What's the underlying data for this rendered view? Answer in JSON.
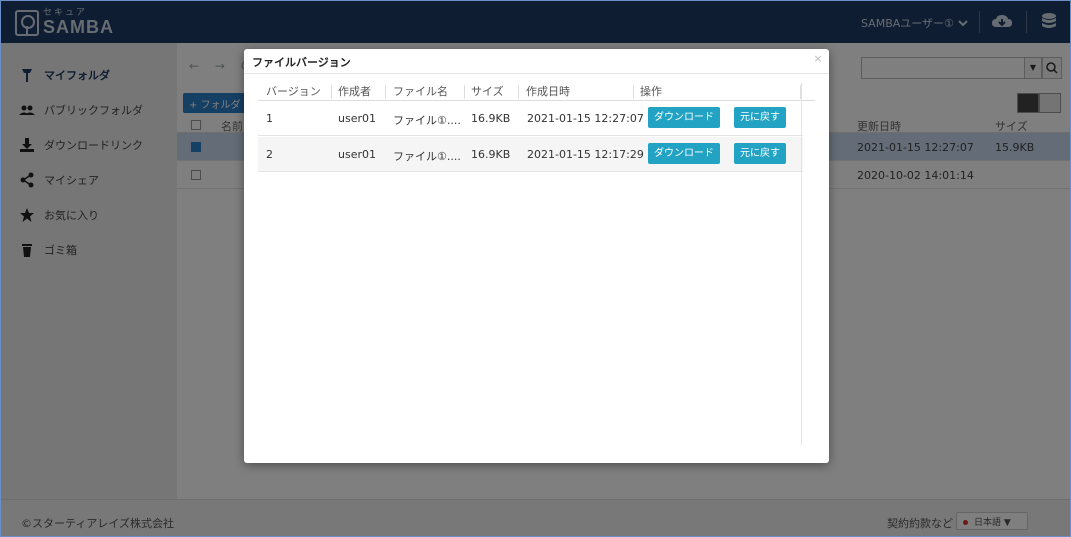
{
  "header": {
    "logo_sub": "セキュア",
    "logo_main": "SAMBA",
    "user_name": "SAMBAユーザー①",
    "colors": {
      "header_bg": "#1d3a63",
      "accent": "#23a3c4"
    }
  },
  "sidebar": {
    "items": [
      {
        "label": "マイフォルダ",
        "icon": "mydrive-icon",
        "active": true
      },
      {
        "label": "パブリックフォルダ",
        "icon": "users-icon"
      },
      {
        "label": "ダウンロードリンク",
        "icon": "download-icon"
      },
      {
        "label": "マイシェア",
        "icon": "share-icon"
      },
      {
        "label": "お気に入り",
        "icon": "star-icon"
      },
      {
        "label": "ゴミ箱",
        "icon": "trash-icon"
      }
    ]
  },
  "main": {
    "nav_arrows": "← → C",
    "new_folder_label": "+ フォルダ",
    "table_headers": {
      "name": "名前",
      "updated": "更新日時",
      "size": "サイズ"
    },
    "rows": [
      {
        "updated": "2021-01-15 12:27:07",
        "size": "15.9KB",
        "checked": true
      },
      {
        "updated": "2020-10-02 14:01:14",
        "size": "",
        "checked": false
      }
    ]
  },
  "footer": {
    "copyright": "©スターティアレイズ株式会社",
    "terms": "契約約款など",
    "language": "日本語"
  },
  "modal": {
    "title": "ファイルバージョン",
    "close": "×",
    "columns": [
      "バージョン",
      "作成者",
      "ファイル名",
      "サイズ",
      "作成日時",
      "操作"
    ],
    "rows": [
      {
        "version": "1",
        "author": "user01",
        "filename": "ファイル①....",
        "size": "16.9KB",
        "created": "2021-01-15 12:27:07",
        "download_label": "ダウンロード",
        "revert_label": "元に戻す"
      },
      {
        "version": "2",
        "author": "user01",
        "filename": "ファイル①....",
        "size": "16.9KB",
        "created": "2021-01-15 12:17:29",
        "download_label": "ダウンロード",
        "revert_label": "元に戻す"
      }
    ]
  }
}
